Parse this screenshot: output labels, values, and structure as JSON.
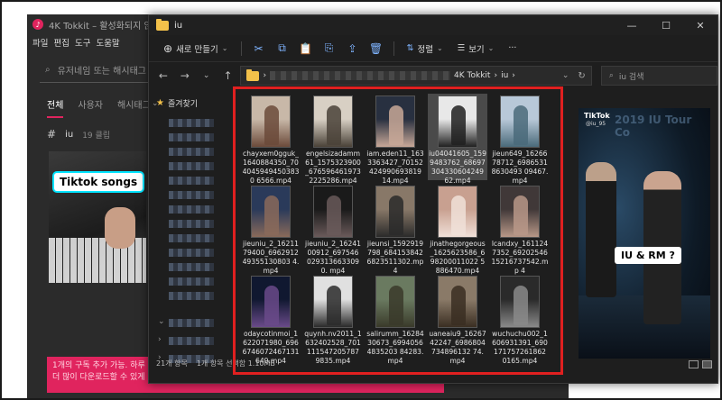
{
  "tokkit": {
    "title": "4K Tokkit – 활성화되지 않음",
    "logo": "♪",
    "menu": [
      "파일",
      "편집",
      "도구",
      "도움말"
    ],
    "search_placeholder": "유저네임 또는 해시태그",
    "tabs": [
      "전체",
      "사용자",
      "해시태그"
    ],
    "hashtag": "iu",
    "hashtag_count": "19 클립",
    "thumb_label": "Tiktok songs",
    "banner_line1": "1개의 구독 추가 가능. 하루",
    "banner_line2": "더 많이 다운로드할 수 있게"
  },
  "explorer": {
    "title": "iu",
    "toolbar": {
      "new_label": "새로 만들기",
      "sort_label": "정렬",
      "view_label": "보기",
      "more_label": "···"
    },
    "address": {
      "crumbs": [
        "4K Tokkit",
        "iu"
      ],
      "search_placeholder": "iu 검색"
    },
    "sidebar": {
      "favorites_label": "즐겨찾기"
    },
    "files": [
      {
        "name": "chayxem0gguk_1640884350_7040459494503830 6566.mp4",
        "bg": "#c8b8a8",
        "fg": "#6b4a3a"
      },
      {
        "name": "engelsizadamm61_1575323900_676596461973 2225286.mp4",
        "bg": "#d8d0c4",
        "fg": "#4a4238"
      },
      {
        "name": "iam.eden11_1633363427_70152424990693819 14.mp4",
        "bg": "#283040",
        "fg": "#c8a898"
      },
      {
        "name": "iu04041605_1599483762_68697304330604249 62.mp4",
        "bg": "#e8e8e8",
        "fg": "#202020"
      },
      {
        "name": "jieun649_1626678712_69865318630493 09467.mp4",
        "bg": "#b8c8d8",
        "fg": "#4a6a7a"
      },
      {
        "name": "jieuniu_2_1621179400_696291249355130803 4.mp4",
        "bg": "#2a3a5a",
        "fg": "#8a6a5a"
      },
      {
        "name": "jieuniu_2_1624100912_697546 0293136633090. mp4",
        "bg": "#1a1a1a",
        "fg": "#6a5a5a"
      },
      {
        "name": "jieunsi_1592919798_684153842 6823511302.mp 4",
        "bg": "#887868",
        "fg": "#2a2a2a"
      },
      {
        "name": "jinathegorgeous_1625623586_698200011022 5886470.mp4",
        "bg": "#c8a090",
        "fg": "#f0e0d8"
      },
      {
        "name": "lcandxy_1611247352_69202546 15216737542.mp 4",
        "bg": "#403838",
        "fg": "#b89888"
      },
      {
        "name": "odaycotinmoi_1622071980_6966746072467131 649.mp4",
        "bg": "#101830",
        "fg": "#6a4a8a"
      },
      {
        "name": "quynh.nv2011_1632402528_701111547205787 9835.mp4",
        "bg": "#e0e0e0",
        "fg": "#2a2a2a"
      },
      {
        "name": "salirumm_1628430673_69940564835203 84283.mp4",
        "bg": "#6a7a60",
        "fg": "#3a3a2a"
      },
      {
        "name": "uaneaiu9_1626742247_6986804734896132 74.mp4",
        "bg": "#8a7a68",
        "fg": "#3a2e22"
      },
      {
        "name": "wuchuchu002_1606931391_690171757261862 0165.mp4",
        "bg": "#2a2a2a",
        "fg": "#8a8a8a"
      }
    ],
    "preview": {
      "brand": "TikTok",
      "user": "@iu_95",
      "stage_text": "2019 IU Tour Co",
      "caption": "IU & RM ?"
    },
    "status": {
      "item_count": "21개 항목",
      "selection": "1개 항목 선택함 1.10MB"
    }
  }
}
